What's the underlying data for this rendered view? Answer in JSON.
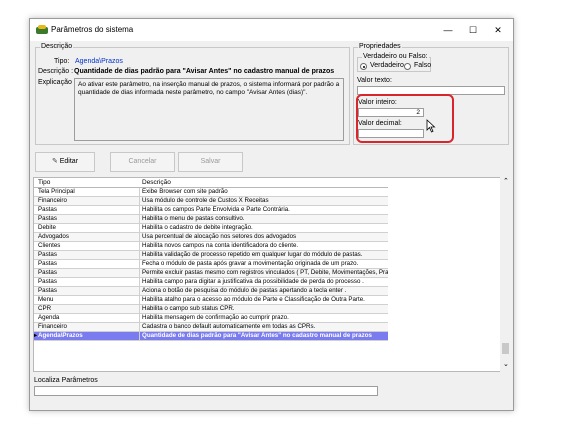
{
  "window": {
    "title": "Parâmetros do sistema",
    "min": "—",
    "max": "☐",
    "close": "✕"
  },
  "descricao": {
    "group_title": "Descrição",
    "tipo_label": "Tipo:",
    "tipo_value": "Agenda\\Prazos",
    "descricao_label": "Descrição :",
    "descricao_value": "Quantidade de dias padrão para \"Avisar Antes\" no cadastro manual de prazos",
    "explicacao_label": "Explicação :",
    "explicacao_value": "Ao ativar este parâmetro, na inserção manual de prazos, o sistema informará por padrão a quantidade de dias informada neste parâmetro, no campo \"Avisar Antes (dias)\"."
  },
  "propriedades": {
    "group_title": "Propriedades",
    "bool_title": "Verdadeiro ou Falso:",
    "true_label": "Verdadeiro",
    "false_label": "Falso",
    "texto_label": "Valor texto:",
    "inteiro_label": "Valor inteiro:",
    "inteiro_value": "2",
    "decimal_label": "Valor decimal:"
  },
  "toolbar": {
    "edit": "Editar",
    "cancel": "Cancelar",
    "save": "Salvar"
  },
  "grid": {
    "headers": [
      "Tipo",
      "Descrição"
    ],
    "rows": [
      [
        "Tela Principal",
        "Exibe Browser com site padrão"
      ],
      [
        "Financeiro",
        "Usa módulo de controle de Custos X Receitas"
      ],
      [
        "Pastas",
        "Habilita os campos Parte Envolvida e Parte Contrária."
      ],
      [
        "Pastas",
        "Habilita o menu de pastas consultivo."
      ],
      [
        "Debite",
        "Habilita o cadastro de debite integração."
      ],
      [
        "Advogados",
        "Usa percentual de alocação nos setores dos advogados"
      ],
      [
        "Clientes",
        "Habilita novos campos na conta identificadora do cliente."
      ],
      [
        "Pastas",
        "Habilita validação de processo repetido em qualquer lugar do módulo de pastas."
      ],
      [
        "Pastas",
        "Fecha o módulo de pasta após gravar a movimentação originada de um prazo."
      ],
      [
        "Pastas",
        "Permite excluir pastas mesmo com registros vinculados ( PT, Debite, Movimentações, Prazo,"
      ],
      [
        "Pastas",
        "Habilita campo para digitar a justificativa da possibilidade de perda do processo ."
      ],
      [
        "Pastas",
        "Aciona o botão de pesquisa do módulo de pastas apertando a tecla enter ."
      ],
      [
        "Menu",
        "Habilita atalho para o acesso ao módulo de Parte e Classificação de Outra Parte."
      ],
      [
        "CPR",
        "Habilita o campo sub status CPR."
      ],
      [
        "Agenda",
        "Habilita mensagem de confirmação ao cumprir prazo."
      ],
      [
        "Financeiro",
        "Cadastra o banco default automaticamente em todas as CPRs."
      ],
      [
        "Agenda\\Prazos",
        "Quantidade de dias padrão para \"Avisar Antes\" no cadastro manual de prazos"
      ]
    ]
  },
  "localiza": {
    "label": "Localiza Parâmetros",
    "value": ""
  },
  "colors": {
    "highlight": "#d9262c",
    "selected_row": "#7b7bf0",
    "link": "#0033cc"
  }
}
